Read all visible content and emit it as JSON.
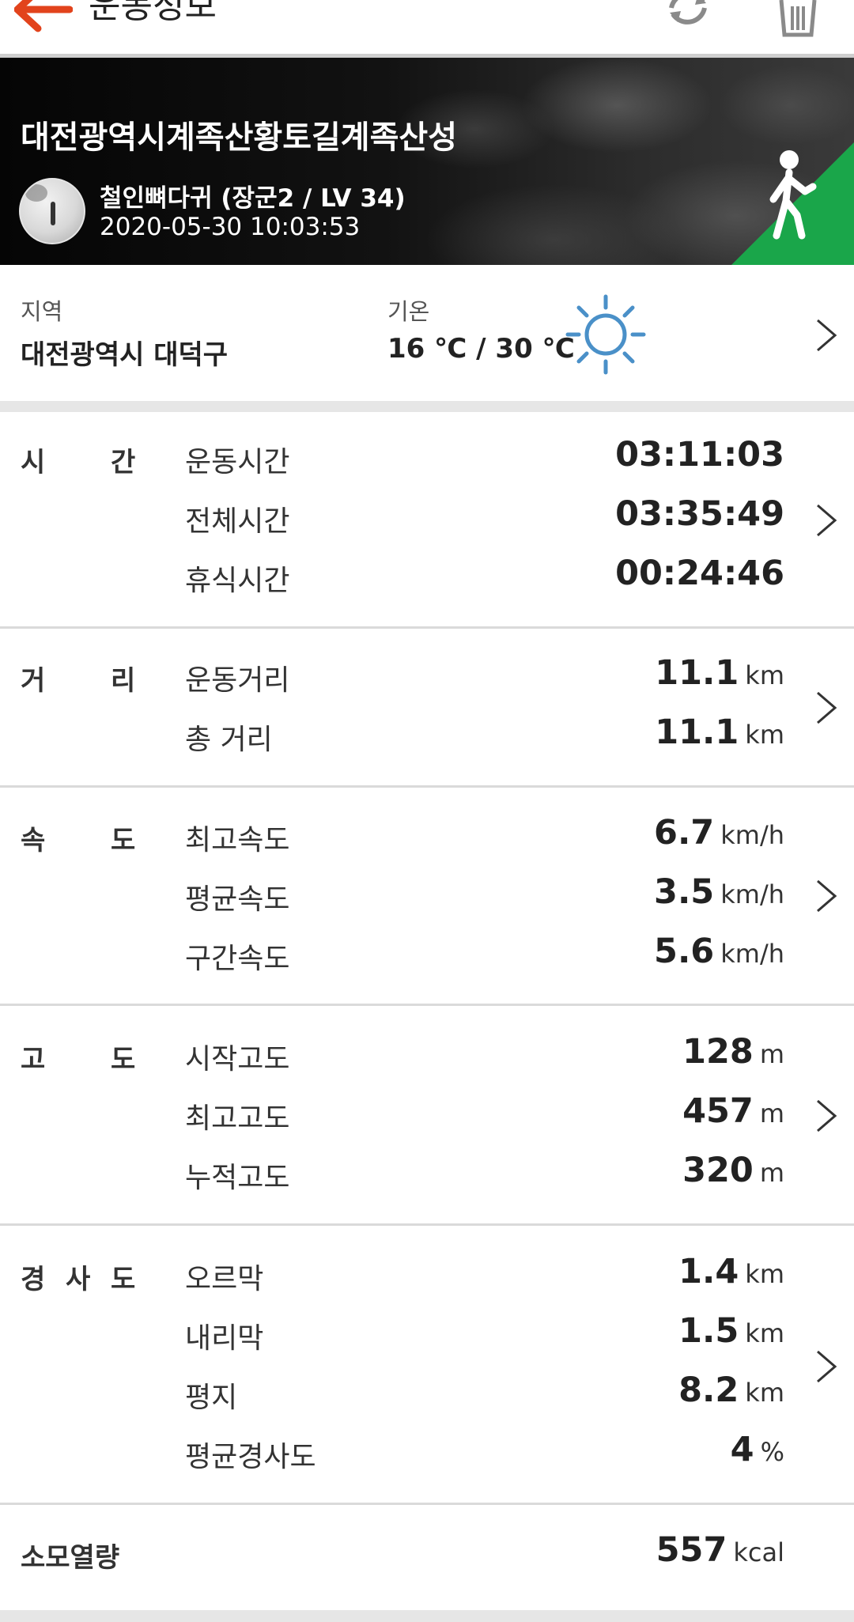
{
  "header": {
    "title": "운동정보"
  },
  "hero": {
    "course_name": "대전광역시계족산황토길계족산성",
    "user": "철인뼈다귀 (장군2 / LV 34)",
    "datetime": "2020-05-30 10:03:53",
    "activity_icon": "walking-icon",
    "accent_color": "#1aa64a"
  },
  "location": {
    "label": "지역",
    "value": "대전광역시 대덕구",
    "temp_label": "기온",
    "temp_value": "16 ℃ / 30 ℃",
    "weather_icon": "sun-icon"
  },
  "sections": {
    "time": {
      "label_a": "시",
      "label_b": "간",
      "rows": [
        {
          "label": "운동시간",
          "value": "03:11:03"
        },
        {
          "label": "전체시간",
          "value": "03:35:49"
        },
        {
          "label": "휴식시간",
          "value": "00:24:46"
        }
      ]
    },
    "distance": {
      "label_a": "거",
      "label_b": "리",
      "rows": [
        {
          "label": "운동거리",
          "value": "11.1",
          "unit": "km"
        },
        {
          "label": "총 거리",
          "value": "11.1",
          "unit": "km"
        }
      ]
    },
    "speed": {
      "label_a": "속",
      "label_b": "도",
      "rows": [
        {
          "label": "최고속도",
          "value": "6.7",
          "unit": "km/h"
        },
        {
          "label": "평균속도",
          "value": "3.5",
          "unit": "km/h"
        },
        {
          "label": "구간속도",
          "value": "5.6",
          "unit": "km/h"
        }
      ]
    },
    "altitude": {
      "label_a": "고",
      "label_b": "도",
      "rows": [
        {
          "label": "시작고도",
          "value": "128",
          "unit": "m"
        },
        {
          "label": "최고고도",
          "value": "457",
          "unit": "m"
        },
        {
          "label": "누적고도",
          "value": "320",
          "unit": "m"
        }
      ]
    },
    "slope": {
      "label_a": "경",
      "label_b": "사",
      "label_c": "도",
      "rows": [
        {
          "label": "오르막",
          "value": "1.4",
          "unit": "km"
        },
        {
          "label": "내리막",
          "value": "1.5",
          "unit": "km"
        },
        {
          "label": "평지",
          "value": "8.2",
          "unit": "km"
        },
        {
          "label": "평균경사도",
          "value": "4",
          "unit": "%"
        }
      ]
    },
    "calories": {
      "label": "소모열량",
      "value": "557",
      "unit": "kcal"
    }
  }
}
